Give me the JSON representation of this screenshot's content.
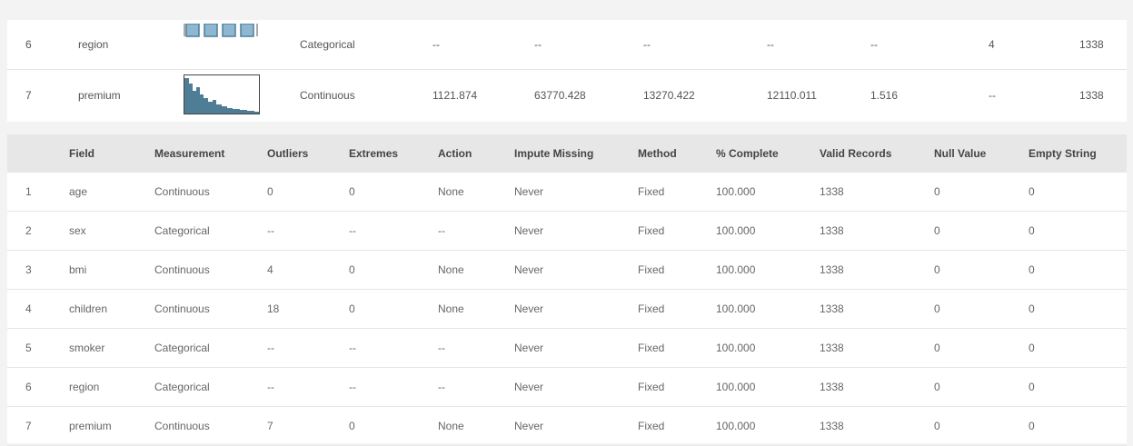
{
  "summary_rows": [
    {
      "index": "6",
      "field": "region",
      "graph": "bar-histogram",
      "measurement": "Categorical",
      "min": "--",
      "max": "--",
      "mean": "--",
      "std_dev": "--",
      "skewness": "--",
      "unique": "4",
      "valid": "1338"
    },
    {
      "index": "7",
      "field": "premium",
      "graph": "continuous-histogram",
      "measurement": "Continuous",
      "min": "1121.874",
      "max": "63770.428",
      "mean": "13270.422",
      "std_dev": "12110.011",
      "skewness": "1.516",
      "unique": "--",
      "valid": "1338"
    }
  ],
  "quality_table": {
    "headers": [
      "",
      "Field",
      "Measurement",
      "Outliers",
      "Extremes",
      "Action",
      "Impute Missing",
      "Method",
      "% Complete",
      "Valid Records",
      "Null Value",
      "Empty String"
    ],
    "rows": [
      {
        "index": "1",
        "field": "age",
        "measurement": "Continuous",
        "outliers": "0",
        "extremes": "0",
        "action": "None",
        "impute": "Never",
        "method": "Fixed",
        "complete": "100.000",
        "valid": "1338",
        "null_value": "0",
        "empty_string": "0"
      },
      {
        "index": "2",
        "field": "sex",
        "measurement": "Categorical",
        "outliers": "--",
        "extremes": "--",
        "action": "--",
        "impute": "Never",
        "method": "Fixed",
        "complete": "100.000",
        "valid": "1338",
        "null_value": "0",
        "empty_string": "0"
      },
      {
        "index": "3",
        "field": "bmi",
        "measurement": "Continuous",
        "outliers": "4",
        "extremes": "0",
        "action": "None",
        "impute": "Never",
        "method": "Fixed",
        "complete": "100.000",
        "valid": "1338",
        "null_value": "0",
        "empty_string": "0"
      },
      {
        "index": "4",
        "field": "children",
        "measurement": "Continuous",
        "outliers": "18",
        "extremes": "0",
        "action": "None",
        "impute": "Never",
        "method": "Fixed",
        "complete": "100.000",
        "valid": "1338",
        "null_value": "0",
        "empty_string": "0"
      },
      {
        "index": "5",
        "field": "smoker",
        "measurement": "Categorical",
        "outliers": "--",
        "extremes": "--",
        "action": "--",
        "impute": "Never",
        "method": "Fixed",
        "complete": "100.000",
        "valid": "1338",
        "null_value": "0",
        "empty_string": "0"
      },
      {
        "index": "6",
        "field": "region",
        "measurement": "Categorical",
        "outliers": "--",
        "extremes": "--",
        "action": "--",
        "impute": "Never",
        "method": "Fixed",
        "complete": "100.000",
        "valid": "1338",
        "null_value": "0",
        "empty_string": "0"
      },
      {
        "index": "7",
        "field": "premium",
        "measurement": "Continuous",
        "outliers": "7",
        "extremes": "0",
        "action": "None",
        "impute": "Never",
        "method": "Fixed",
        "complete": "100.000",
        "valid": "1338",
        "null_value": "0",
        "empty_string": "0"
      }
    ]
  },
  "colors": {
    "bar_fill": "#8fb8d0",
    "bar_stroke": "#4d7f9c",
    "area_fill": "#4e7d95"
  }
}
